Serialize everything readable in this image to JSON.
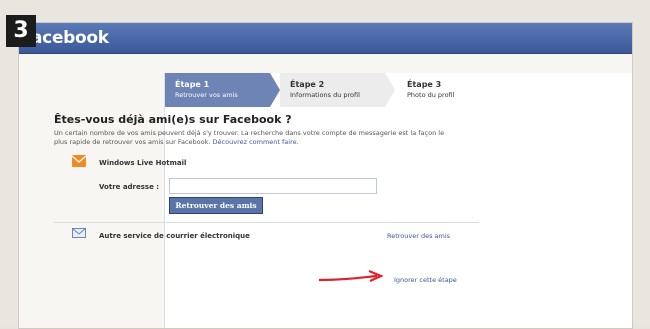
{
  "step_number": "3",
  "brand": "acebook",
  "wizard": {
    "steps": [
      {
        "title": "Étape 1",
        "subtitle": "Retrouver vos amis"
      },
      {
        "title": "Étape 2",
        "subtitle": "Informations du profil"
      },
      {
        "title": "Étape 3",
        "subtitle": "Photo du profil"
      }
    ]
  },
  "find_friends": {
    "heading": "Êtes-vous déjà ami(e)s sur Facebook ?",
    "description": "Un certain nombre de vos amis peuvent déjà s'y trouver. La recherche dans votre compte de messagerie est la façon le plus rapide de retrouver vos amis sur Facebook.",
    "learn_link": "Découvrez comment faire.",
    "provider_label": "Windows Live Hotmail",
    "address_label": "Votre adresse :",
    "address_value": "",
    "find_button": "Retrouver des amis",
    "other_service_label": "Autre service de courrier électronique",
    "other_service_link": "Retrouver des amis",
    "skip_link": "Ignorer cette étape"
  },
  "colors": {
    "facebook_blue": "#3b5998",
    "step_active": "#6d84b4",
    "arrow_red": "#e0202a"
  }
}
